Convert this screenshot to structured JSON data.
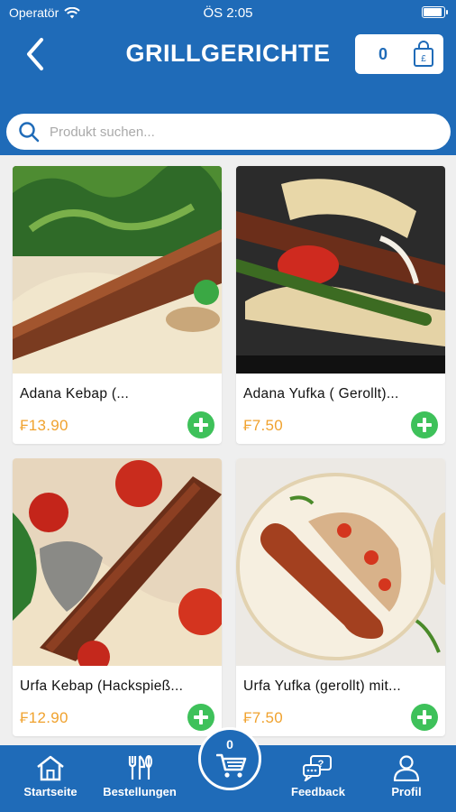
{
  "status_bar": {
    "carrier": "Operatör",
    "time": "ÖS 2:05"
  },
  "header": {
    "title": "GRILLGERICHTE",
    "cart_count": "0"
  },
  "search": {
    "placeholder": "Produkt suchen..."
  },
  "colors": {
    "primary": "#1f6bb8",
    "price": "#f0a22e",
    "add": "#3ec15a"
  },
  "products": [
    {
      "name": "Adana Kebap (...",
      "price": "₣13.90"
    },
    {
      "name": "Adana Yufka ( Gerollt)...",
      "price": "₣7.50"
    },
    {
      "name": "Urfa Kebap (Hackspieß...",
      "price": "₣12.90"
    },
    {
      "name": "Urfa Yufka (gerollt) mit...",
      "price": "₣7.50"
    }
  ],
  "tabbar": {
    "cart_count": "0",
    "items": [
      {
        "label": "Startseite",
        "icon": "home-icon"
      },
      {
        "label": "Bestellungen",
        "icon": "cutlery-icon"
      },
      {
        "label": "Feedback",
        "icon": "feedback-icon"
      },
      {
        "label": "Profil",
        "icon": "profile-icon"
      }
    ]
  }
}
